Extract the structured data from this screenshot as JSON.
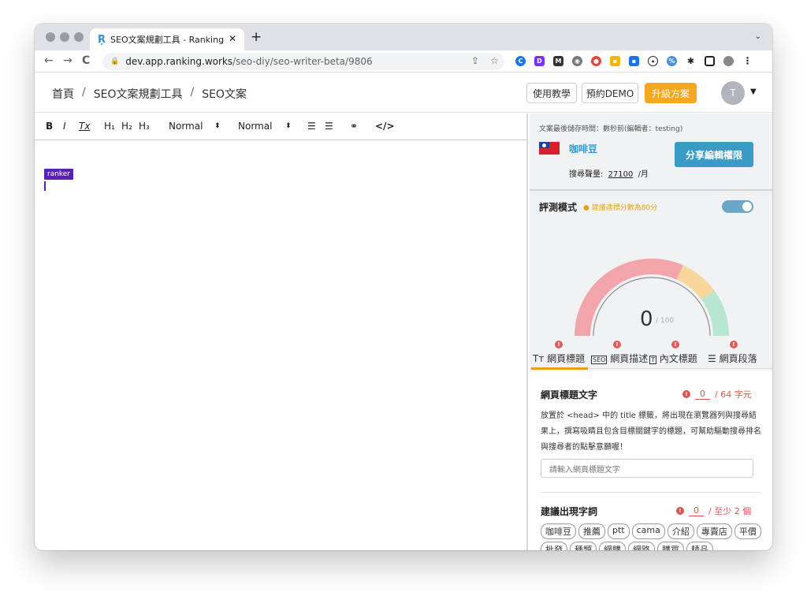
{
  "browser": {
    "tab_title": "SEO文案規劃工具 - Ranking",
    "tab_favicon": "Ŗ",
    "new_tab": "+",
    "url_host": "dev.app.ranking.works",
    "url_path": "/seo-diy/seo-writer-beta/9806"
  },
  "header": {
    "breadcrumb": [
      "首頁",
      "SEO文案規劃工具",
      "SEO文案"
    ],
    "breadcrumb_sep": "/",
    "tutorial_button": "使用教學",
    "demo_button": "預約DEMO",
    "upgrade_button": "升級方案",
    "avatar_initial": "T"
  },
  "editor": {
    "toolbar": {
      "bold": "B",
      "italic": "I",
      "clear_format": "Tx",
      "h1": "H₁",
      "h2": "H₂",
      "h3": "H₃",
      "font_size": "Normal",
      "font_family": "Normal"
    },
    "cursor_label": "ranker"
  },
  "panel": {
    "save_time": "文案最後儲存時間：數秒前(編輯者：testing)",
    "keyword": "咖啡豆",
    "share_button": "分享編輯權限",
    "search_volume_label": "搜尋聲量:",
    "search_volume": "27100",
    "search_volume_unit": "/月",
    "mode_title": "評測模式",
    "mode_tip": "建議達標分數為80分",
    "mode_enabled": true,
    "score": "0",
    "score_max": "/ 100",
    "gauge_colors": [
      "#f2a6ab",
      "#f7d79c",
      "#b9e5d3"
    ],
    "tabs": [
      {
        "label": "網頁標題",
        "icon": "text-size-icon"
      },
      {
        "label": "網頁描述",
        "icon": "seo-icon"
      },
      {
        "label": "內文標題",
        "icon": "title-box-icon"
      },
      {
        "label": "網頁段落",
        "icon": "paragraph-icon"
      }
    ],
    "title_section": {
      "heading": "網頁標題文字",
      "count": "0",
      "limit": "/ 64 字元",
      "description": "放置於 <head> 中的 title 標籤，將出現在瀏覽器列與搜尋結果上，撰寫吸睛且包含目標關鍵字的標題，可幫助驅動搜尋排名與搜尋者的點擊意願喔！",
      "input_placeholder": "請輸入網頁標題文字"
    },
    "words_section": {
      "heading": "建議出現字詞",
      "count": "0",
      "limit": "/ 至少 2 個",
      "chips": [
        "咖啡豆",
        "推薦",
        "ptt",
        "cama",
        "介紹",
        "專賣店",
        "平價",
        "批發",
        "種類",
        "網購",
        "網路",
        "購買",
        "精品"
      ]
    }
  }
}
